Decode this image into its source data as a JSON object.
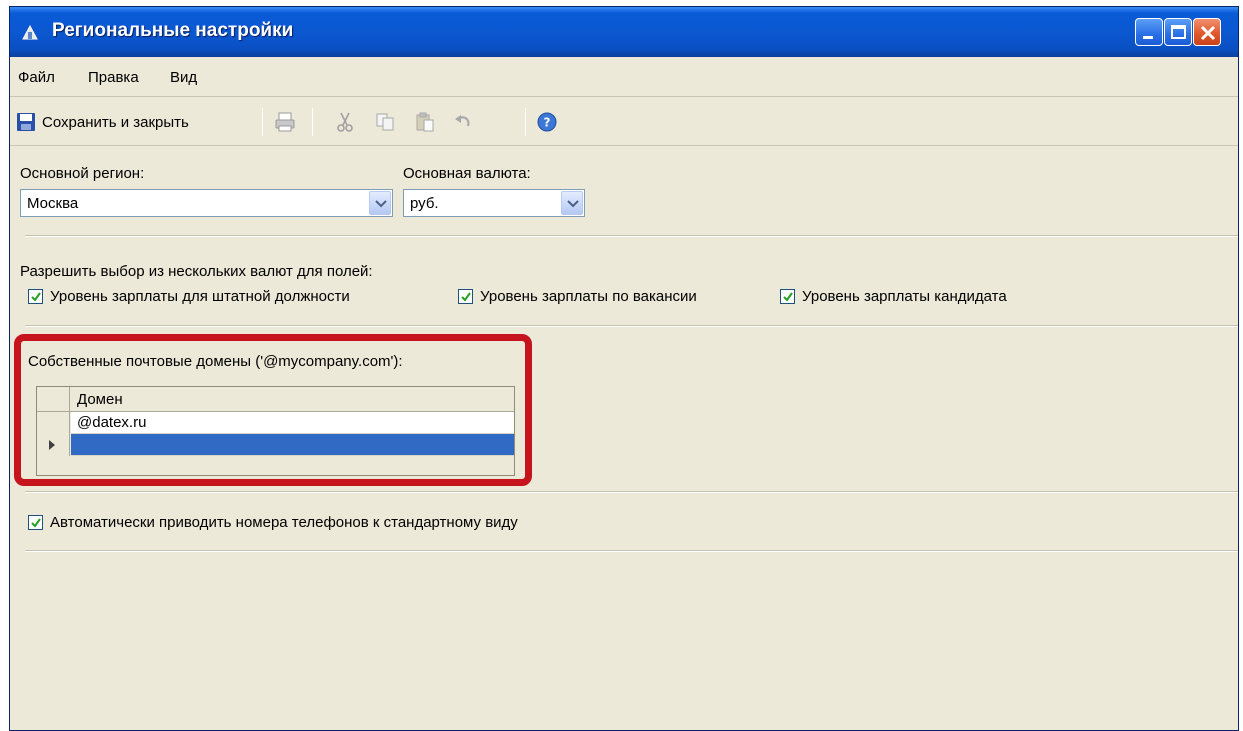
{
  "window": {
    "title": "Региональные настройки"
  },
  "menu": {
    "file": "Файл",
    "edit": "Правка",
    "view": "Вид"
  },
  "toolbar": {
    "save_label": "Сохранить и закрыть",
    "icons": [
      "print-icon",
      "cut-icon",
      "copy-icon",
      "paste-icon",
      "undo-icon",
      "help-icon"
    ]
  },
  "region": {
    "label": "Основной регион:",
    "value": "Москва"
  },
  "currency": {
    "label": "Основная валюта:",
    "value": "руб."
  },
  "multi_currency": {
    "label": "Разрешить выбор из нескольких валют для полей:",
    "options": [
      {
        "label": "Уровень зарплаты для штатной должности",
        "checked": true
      },
      {
        "label": "Уровень зарплаты по вакансии",
        "checked": true
      },
      {
        "label": "Уровень зарплаты кандидата",
        "checked": true
      }
    ]
  },
  "domains": {
    "label": "Собственные почтовые домены ('@mycompany.com'):",
    "column": "Домен",
    "rows": [
      "@datex.ru",
      ""
    ]
  },
  "phone_format": {
    "label": "Автоматически приводить номера телефонов к стандартному виду",
    "checked": true
  },
  "colors": {
    "title_bar": "#0b57d0",
    "selection": "#316ac5",
    "highlight_frame": "#c5141e",
    "window_bg": "#ece9d8"
  }
}
